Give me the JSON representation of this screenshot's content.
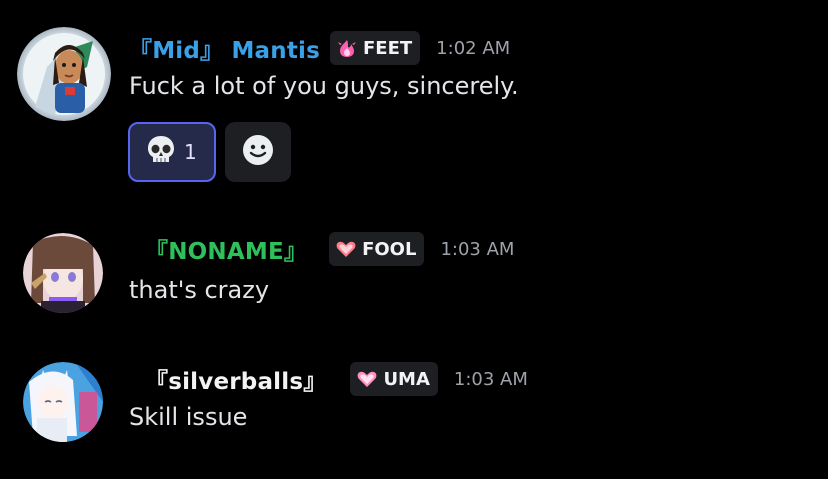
{
  "messages": [
    {
      "username": "『Mid』 Mantis",
      "username_color": "#3aa0e8",
      "tag_label": "FEET",
      "tag_icon": "pink-flame-icon",
      "timestamp": "1:02 AM",
      "content": "Fuck a lot of you guys, sincerely.",
      "reactions": [
        {
          "emoji": "💀",
          "count": "1",
          "icon": "skull-emoji-icon"
        }
      ]
    },
    {
      "username": "『NONAME』",
      "username_color": "#2ec05a",
      "tag_label": "FOOL",
      "tag_icon": "pixel-heart-icon",
      "timestamp": "1:03 AM",
      "content": "that's crazy"
    },
    {
      "username": "『silverballs』",
      "username_color": "#f2f3f5",
      "tag_label": "UMA",
      "tag_icon": "pink-heart-icon",
      "timestamp": "1:03 AM",
      "content": "Skill issue"
    }
  ],
  "colors": {
    "background": "#000000",
    "tag_background": "#1e1f22",
    "reaction_active_border": "#5865f2",
    "reaction_active_background": "#252a4a",
    "timestamp": "#9ea2a9",
    "message_text": "#e3e5e8"
  },
  "icons": [
    "avatar-mantis",
    "avatar-noname",
    "avatar-silverballs",
    "add-reaction-smiley-icon"
  ]
}
